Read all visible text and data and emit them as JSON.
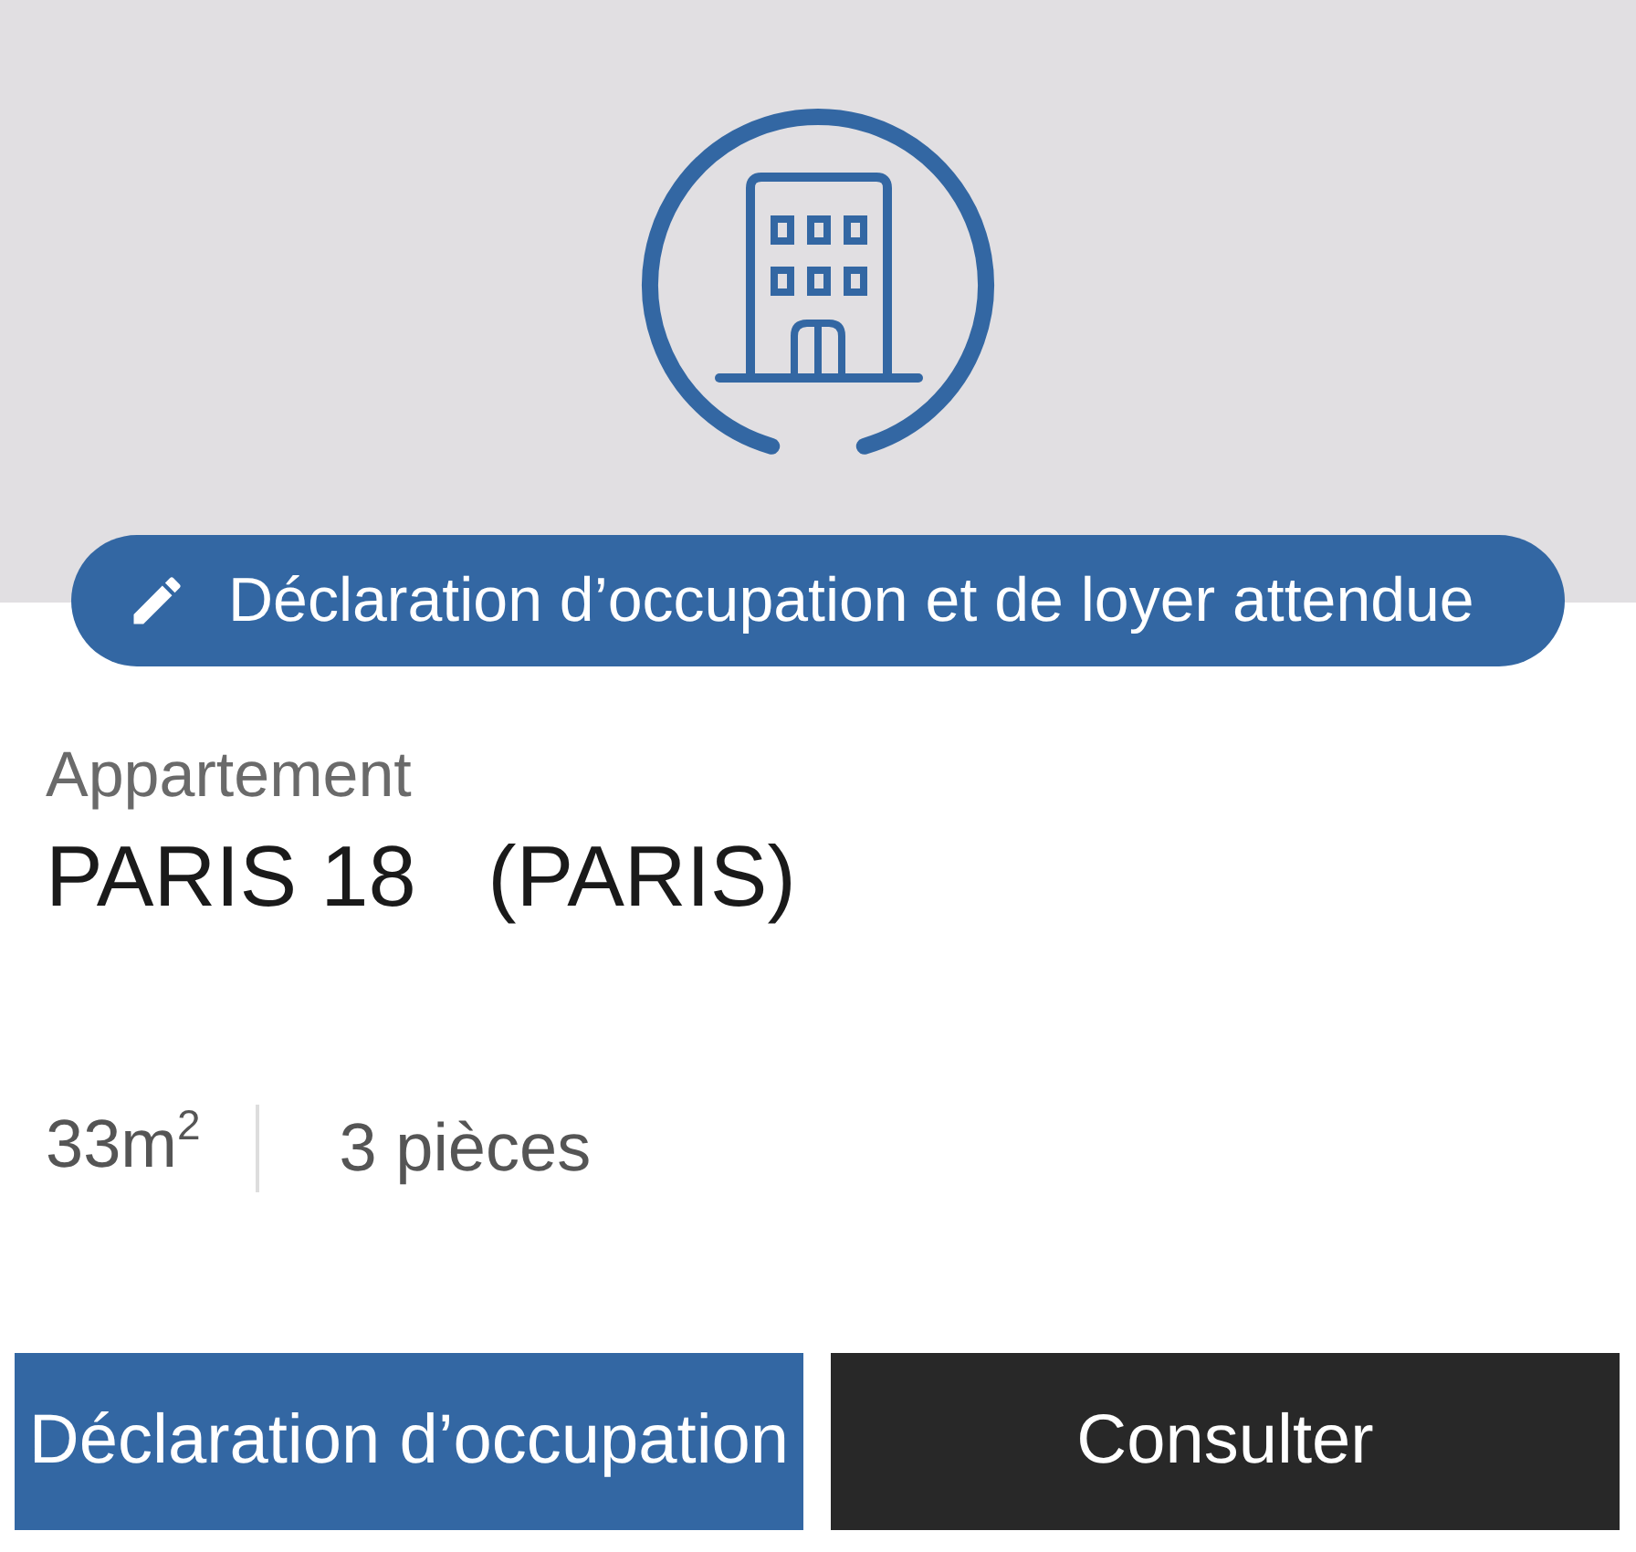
{
  "header": {
    "badge": {
      "label": "Déclaration d’occupation et de loyer attendue"
    }
  },
  "property": {
    "type": "Appartement",
    "location": "PARIS 18   (PARIS)"
  },
  "features": [
    {
      "text": "33m$^{2}$"
    },
    {
      "text": "3 pièces"
    }
  ],
  "buttons": [
    {
      "label": "Déclaration d’occupation",
      "kind": "primary"
    },
    {
      "label": "Consulter",
      "kind": "dark"
    }
  ]
}
